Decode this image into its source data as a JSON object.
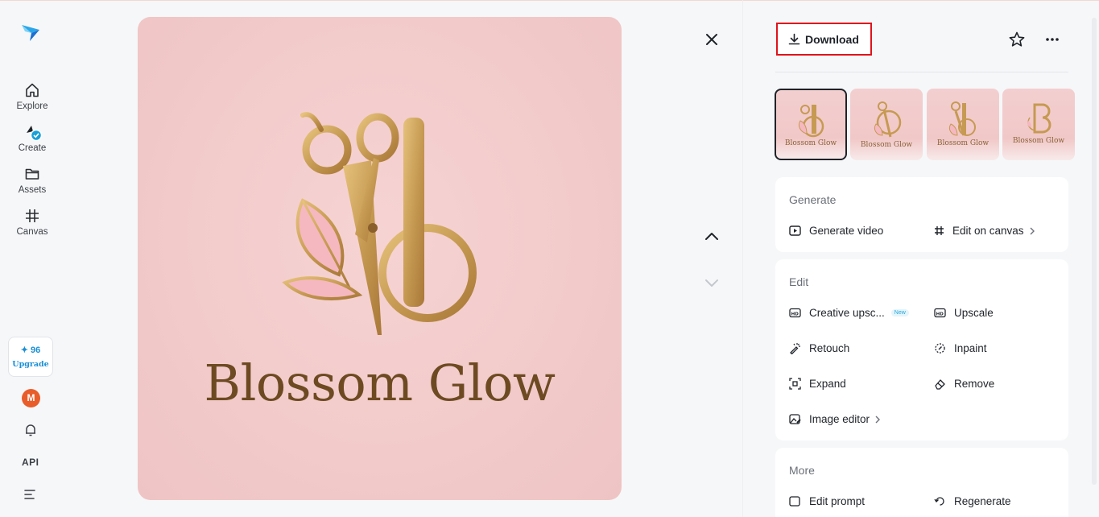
{
  "nav": {
    "items": [
      {
        "label": "Explore",
        "icon": "home-icon"
      },
      {
        "label": "Create",
        "icon": "brush-icon"
      },
      {
        "label": "Assets",
        "icon": "folder-icon"
      },
      {
        "label": "Canvas",
        "icon": "canvas-icon"
      }
    ],
    "credits": "✦ 96",
    "upgrade": "Upgrade",
    "avatar_initial": "M",
    "api": "API"
  },
  "image": {
    "brand_text": "Blossom Glow"
  },
  "toolbar": {
    "download_label": "Download"
  },
  "thumbnails": [
    {
      "label": "Blossom Glow",
      "selected": true
    },
    {
      "label": "Blossom Glow",
      "selected": false
    },
    {
      "label": "Blossom Glow",
      "selected": false
    },
    {
      "label": "Blossom Glow",
      "selected": false
    }
  ],
  "generate": {
    "title": "Generate",
    "generate_video": "Generate video",
    "edit_on_canvas": "Edit on canvas"
  },
  "edit": {
    "title": "Edit",
    "creative_upscale": "Creative upsc...",
    "new_badge": "New",
    "upscale": "Upscale",
    "retouch": "Retouch",
    "inpaint": "Inpaint",
    "expand": "Expand",
    "remove": "Remove",
    "image_editor": "Image editor"
  },
  "more": {
    "title": "More",
    "edit_prompt": "Edit prompt",
    "regenerate": "Regenerate"
  },
  "colors": {
    "accent": "#1a8fd6",
    "highlight": "#e0131b",
    "gold": "#c8a058",
    "image_bg": "#f2caca"
  }
}
